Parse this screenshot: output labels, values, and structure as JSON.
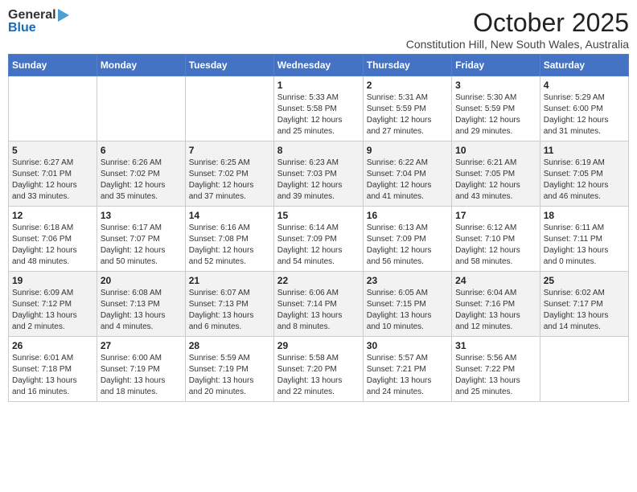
{
  "logo": {
    "general": "General",
    "blue": "Blue"
  },
  "title": "October 2025",
  "subtitle": "Constitution Hill, New South Wales, Australia",
  "days_of_week": [
    "Sunday",
    "Monday",
    "Tuesday",
    "Wednesday",
    "Thursday",
    "Friday",
    "Saturday"
  ],
  "weeks": [
    [
      {
        "day": "",
        "info": ""
      },
      {
        "day": "",
        "info": ""
      },
      {
        "day": "",
        "info": ""
      },
      {
        "day": "1",
        "info": "Sunrise: 5:33 AM\nSunset: 5:58 PM\nDaylight: 12 hours\nand 25 minutes."
      },
      {
        "day": "2",
        "info": "Sunrise: 5:31 AM\nSunset: 5:59 PM\nDaylight: 12 hours\nand 27 minutes."
      },
      {
        "day": "3",
        "info": "Sunrise: 5:30 AM\nSunset: 5:59 PM\nDaylight: 12 hours\nand 29 minutes."
      },
      {
        "day": "4",
        "info": "Sunrise: 5:29 AM\nSunset: 6:00 PM\nDaylight: 12 hours\nand 31 minutes."
      }
    ],
    [
      {
        "day": "5",
        "info": "Sunrise: 6:27 AM\nSunset: 7:01 PM\nDaylight: 12 hours\nand 33 minutes."
      },
      {
        "day": "6",
        "info": "Sunrise: 6:26 AM\nSunset: 7:02 PM\nDaylight: 12 hours\nand 35 minutes."
      },
      {
        "day": "7",
        "info": "Sunrise: 6:25 AM\nSunset: 7:02 PM\nDaylight: 12 hours\nand 37 minutes."
      },
      {
        "day": "8",
        "info": "Sunrise: 6:23 AM\nSunset: 7:03 PM\nDaylight: 12 hours\nand 39 minutes."
      },
      {
        "day": "9",
        "info": "Sunrise: 6:22 AM\nSunset: 7:04 PM\nDaylight: 12 hours\nand 41 minutes."
      },
      {
        "day": "10",
        "info": "Sunrise: 6:21 AM\nSunset: 7:05 PM\nDaylight: 12 hours\nand 43 minutes."
      },
      {
        "day": "11",
        "info": "Sunrise: 6:19 AM\nSunset: 7:05 PM\nDaylight: 12 hours\nand 46 minutes."
      }
    ],
    [
      {
        "day": "12",
        "info": "Sunrise: 6:18 AM\nSunset: 7:06 PM\nDaylight: 12 hours\nand 48 minutes."
      },
      {
        "day": "13",
        "info": "Sunrise: 6:17 AM\nSunset: 7:07 PM\nDaylight: 12 hours\nand 50 minutes."
      },
      {
        "day": "14",
        "info": "Sunrise: 6:16 AM\nSunset: 7:08 PM\nDaylight: 12 hours\nand 52 minutes."
      },
      {
        "day": "15",
        "info": "Sunrise: 6:14 AM\nSunset: 7:09 PM\nDaylight: 12 hours\nand 54 minutes."
      },
      {
        "day": "16",
        "info": "Sunrise: 6:13 AM\nSunset: 7:09 PM\nDaylight: 12 hours\nand 56 minutes."
      },
      {
        "day": "17",
        "info": "Sunrise: 6:12 AM\nSunset: 7:10 PM\nDaylight: 12 hours\nand 58 minutes."
      },
      {
        "day": "18",
        "info": "Sunrise: 6:11 AM\nSunset: 7:11 PM\nDaylight: 13 hours\nand 0 minutes."
      }
    ],
    [
      {
        "day": "19",
        "info": "Sunrise: 6:09 AM\nSunset: 7:12 PM\nDaylight: 13 hours\nand 2 minutes."
      },
      {
        "day": "20",
        "info": "Sunrise: 6:08 AM\nSunset: 7:13 PM\nDaylight: 13 hours\nand 4 minutes."
      },
      {
        "day": "21",
        "info": "Sunrise: 6:07 AM\nSunset: 7:13 PM\nDaylight: 13 hours\nand 6 minutes."
      },
      {
        "day": "22",
        "info": "Sunrise: 6:06 AM\nSunset: 7:14 PM\nDaylight: 13 hours\nand 8 minutes."
      },
      {
        "day": "23",
        "info": "Sunrise: 6:05 AM\nSunset: 7:15 PM\nDaylight: 13 hours\nand 10 minutes."
      },
      {
        "day": "24",
        "info": "Sunrise: 6:04 AM\nSunset: 7:16 PM\nDaylight: 13 hours\nand 12 minutes."
      },
      {
        "day": "25",
        "info": "Sunrise: 6:02 AM\nSunset: 7:17 PM\nDaylight: 13 hours\nand 14 minutes."
      }
    ],
    [
      {
        "day": "26",
        "info": "Sunrise: 6:01 AM\nSunset: 7:18 PM\nDaylight: 13 hours\nand 16 minutes."
      },
      {
        "day": "27",
        "info": "Sunrise: 6:00 AM\nSunset: 7:19 PM\nDaylight: 13 hours\nand 18 minutes."
      },
      {
        "day": "28",
        "info": "Sunrise: 5:59 AM\nSunset: 7:19 PM\nDaylight: 13 hours\nand 20 minutes."
      },
      {
        "day": "29",
        "info": "Sunrise: 5:58 AM\nSunset: 7:20 PM\nDaylight: 13 hours\nand 22 minutes."
      },
      {
        "day": "30",
        "info": "Sunrise: 5:57 AM\nSunset: 7:21 PM\nDaylight: 13 hours\nand 24 minutes."
      },
      {
        "day": "31",
        "info": "Sunrise: 5:56 AM\nSunset: 7:22 PM\nDaylight: 13 hours\nand 25 minutes."
      },
      {
        "day": "",
        "info": ""
      }
    ]
  ]
}
